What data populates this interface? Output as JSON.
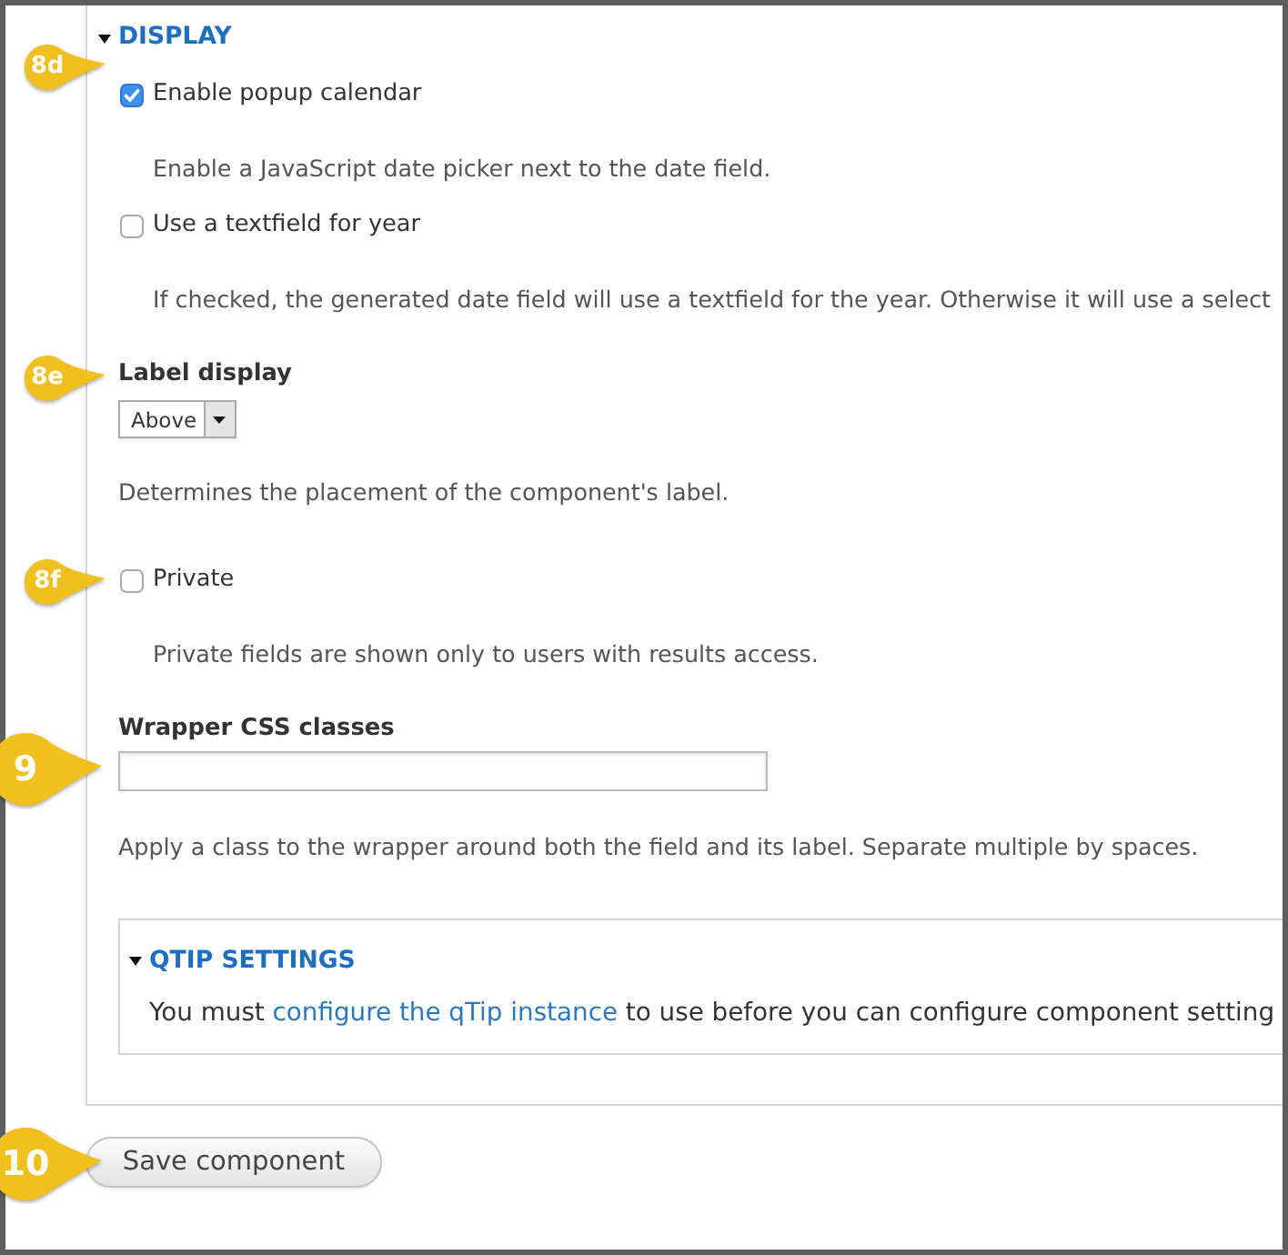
{
  "display_section": {
    "title": "DISPLAY",
    "expanded": true,
    "callout": {
      "label": "8d",
      "kind": "substep"
    },
    "items": [
      {
        "kind": "checkbox",
        "label": "Enable popup calendar",
        "checked": true,
        "description": "Enable a JavaScript date picker next to the date field."
      },
      {
        "kind": "checkbox",
        "label": "Use a textfield for year",
        "checked": false,
        "description": "If checked, the generated date field will use a textfield for the year. Otherwise it will use a select"
      },
      {
        "kind": "select",
        "label": "Label display",
        "value": "Above",
        "description": "Determines the placement of the component's label.",
        "callout": {
          "label": "8e",
          "kind": "substep"
        }
      },
      {
        "kind": "checkbox",
        "label": "Private",
        "checked": false,
        "description": "Private fields are shown only to users with results access.",
        "callout": {
          "label": "8f",
          "kind": "substep"
        }
      },
      {
        "kind": "textfield",
        "label": "Wrapper CSS classes",
        "description": "Apply a class to the wrapper around both the field and its label. Separate multiple by spaces.",
        "callout": {
          "label": "9",
          "kind": "step"
        }
      }
    ],
    "qtip_section": {
      "title": "QTIP SETTINGS",
      "expanded": true,
      "message": [
        {
          "kind": "text",
          "text": "You must "
        },
        {
          "kind": "link",
          "text": "configure the qTip instance"
        },
        {
          "kind": "text",
          "text": " to use before you can configure component setting"
        }
      ]
    }
  },
  "save_button": {
    "label": "Save component",
    "callout": {
      "label": "10",
      "kind": "step"
    }
  }
}
